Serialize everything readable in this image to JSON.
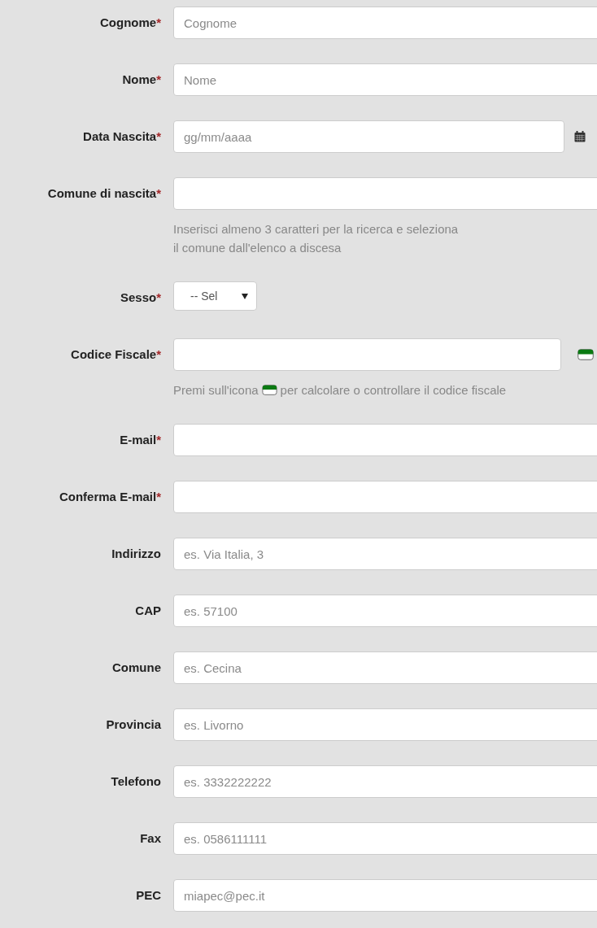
{
  "fields": [
    {
      "kind": "text",
      "label": "Cognome",
      "mark": "*",
      "placeholder": "Cognome"
    },
    {
      "kind": "text",
      "label": "Nome",
      "mark": "*",
      "placeholder": "Nome"
    },
    {
      "kind": "date",
      "label": "Data Nascita",
      "mark": "*",
      "placeholder": "gg/mm/aaaa"
    },
    {
      "kind": "text",
      "label": "Comune di nascita",
      "mark": "*",
      "help_lines": [
        "Inserisci almeno 3 caratteri per la ricerca e seleziona",
        "il comune dall'elenco a discesa"
      ]
    },
    {
      "kind": "select",
      "label": "Sesso",
      "mark": "*",
      "value": "-- Sel"
    },
    {
      "kind": "fiscal",
      "label": "Codice Fiscale",
      "mark": "*",
      "help_before": "Premi sull'icona",
      "help_after": "per calcolare o controllare il codice fiscale"
    },
    {
      "kind": "text",
      "label": "E-mail",
      "mark": "*"
    },
    {
      "kind": "text",
      "label": "Conferma E-mail",
      "mark": "*"
    },
    {
      "kind": "text",
      "label": "Indirizzo",
      "placeholder": "es. Via Italia, 3"
    },
    {
      "kind": "text",
      "label": "CAP",
      "placeholder": "es. 57100"
    },
    {
      "kind": "text",
      "label": "Comune",
      "placeholder": "es. Cecina"
    },
    {
      "kind": "text",
      "label": "Provincia",
      "placeholder": "es. Livorno"
    },
    {
      "kind": "text",
      "label": "Telefono",
      "placeholder": "es. 3332222222"
    },
    {
      "kind": "text",
      "label": "Fax",
      "placeholder": "es. 0586111111"
    },
    {
      "kind": "text",
      "label": "PEC",
      "placeholder": "miapec@pec.it"
    }
  ]
}
